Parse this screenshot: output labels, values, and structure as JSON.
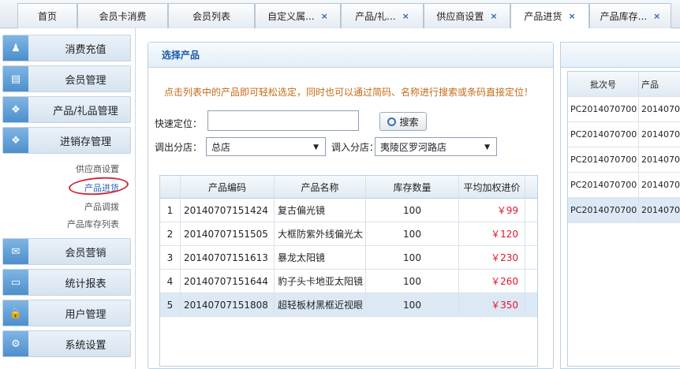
{
  "tabs": [
    {
      "label": "首页",
      "closable": false
    },
    {
      "label": "会员卡消费",
      "closable": false
    },
    {
      "label": "会员列表",
      "closable": false
    },
    {
      "label": "自定义属...",
      "closable": true
    },
    {
      "label": "产品/礼...",
      "closable": true
    },
    {
      "label": "供应商设置",
      "closable": true
    },
    {
      "label": "产品进货",
      "closable": true
    },
    {
      "label": "产品库存...",
      "closable": true
    }
  ],
  "close_glyph": "×",
  "sidebar": {
    "menus": [
      {
        "label": "消费充值",
        "icon": "user-icon",
        "glyph": "♟"
      },
      {
        "label": "会员管理",
        "icon": "card-icon",
        "glyph": "▤"
      },
      {
        "label": "产品/礼品管理",
        "icon": "gift-icon",
        "glyph": "❖"
      },
      {
        "label": "进销存管理",
        "icon": "inventory-icon",
        "glyph": "❖"
      },
      {
        "label": "会员营销",
        "icon": "mail-icon",
        "glyph": "✉"
      },
      {
        "label": "统计报表",
        "icon": "monitor-icon",
        "glyph": "▭"
      },
      {
        "label": "用户管理",
        "icon": "lock-icon",
        "glyph": "🔒"
      },
      {
        "label": "系统设置",
        "icon": "gear-icon",
        "glyph": "⚙"
      }
    ],
    "submenu": [
      {
        "label": "供应商设置"
      },
      {
        "label": "产品进货"
      },
      {
        "label": "产品调拨"
      },
      {
        "label": "产品库存列表"
      }
    ]
  },
  "panel": {
    "title": "选择产品",
    "hint": "点击列表中的产品即可轻松选定，同时也可以通过简码、名称进行搜索或条码直接定位！",
    "quick_label": "快速定位：",
    "quick_value": "",
    "search_label": "搜索",
    "out_label": "调出分店：",
    "out_value": "总店",
    "in_label": "调入分店：",
    "in_value": "夷陵区罗河路店",
    "grid": {
      "columns": [
        "产品编码",
        "产品名称",
        "库存数量",
        "平均加权进价"
      ],
      "rows": [
        {
          "n": "1",
          "code": "20140707151424",
          "name": "复古偏光镜",
          "qty": "100",
          "price": "￥99"
        },
        {
          "n": "2",
          "code": "20140707151505",
          "name": "大框防紫外线偏光太",
          "qty": "100",
          "price": "￥120"
        },
        {
          "n": "3",
          "code": "20140707151613",
          "name": "暴龙太阳镜",
          "qty": "100",
          "price": "￥230"
        },
        {
          "n": "4",
          "code": "20140707151644",
          "name": "豹子头卡地亚太阳镜",
          "qty": "100",
          "price": "￥260"
        },
        {
          "n": "5",
          "code": "20140707151808",
          "name": "超轻板材黑框近视眼",
          "qty": "100",
          "price": "￥350"
        }
      ]
    }
  },
  "right_grid": {
    "columns": [
      "批次号",
      "产品"
    ],
    "rows": [
      {
        "batch": "PC2014070700",
        "code": "2014070"
      },
      {
        "batch": "PC2014070700",
        "code": "2014070"
      },
      {
        "batch": "PC2014070700",
        "code": "2014070"
      },
      {
        "batch": "PC2014070700",
        "code": "2014070"
      },
      {
        "batch": "PC2014070700",
        "code": "2014070"
      }
    ]
  },
  "colors": {
    "accent": "#2c64b8",
    "price": "#e0162b",
    "hint": "#c46a16",
    "annotation": "#d0283a"
  }
}
